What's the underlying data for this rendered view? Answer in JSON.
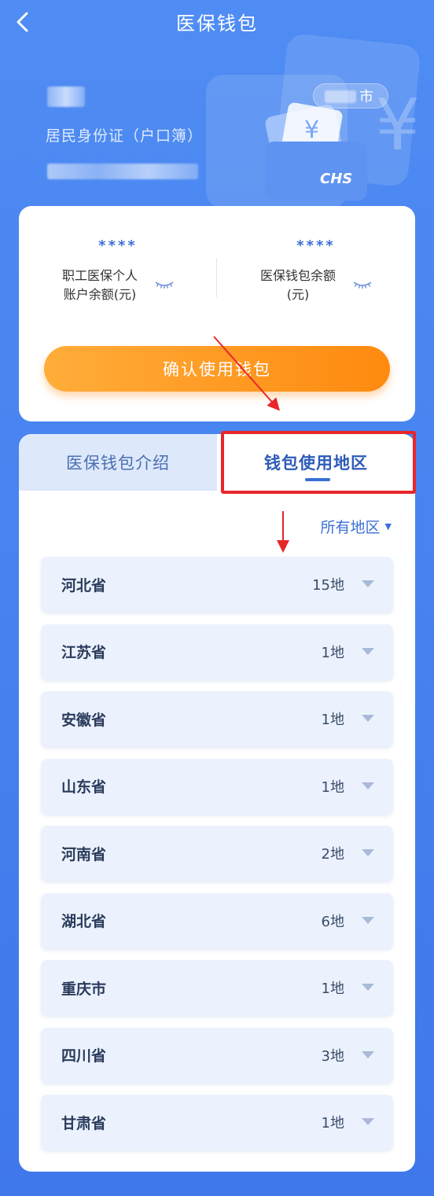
{
  "header": {
    "title": "医保钱包"
  },
  "hero": {
    "id_type": "居民身份证（户口簿）",
    "city_suffix": "市"
  },
  "balance": {
    "left": {
      "amount": "****",
      "label_line1": "职工医保个人",
      "label_line2": "账户余额(元)"
    },
    "right": {
      "amount": "****",
      "label_line1": "医保钱包余额",
      "label_line2": "(元)"
    },
    "confirm_label": "确认使用钱包"
  },
  "tabs": [
    {
      "label": "医保钱包介绍",
      "active": false
    },
    {
      "label": "钱包使用地区",
      "active": true
    }
  ],
  "filter": {
    "label": "所有地区"
  },
  "regions": [
    {
      "name": "河北省",
      "count": "15地"
    },
    {
      "name": "江苏省",
      "count": "1地"
    },
    {
      "name": "安徽省",
      "count": "1地"
    },
    {
      "name": "山东省",
      "count": "1地"
    },
    {
      "name": "河南省",
      "count": "2地"
    },
    {
      "name": "湖北省",
      "count": "6地"
    },
    {
      "name": "重庆市",
      "count": "1地"
    },
    {
      "name": "四川省",
      "count": "3地"
    },
    {
      "name": "甘肃省",
      "count": "1地"
    }
  ],
  "colors": {
    "accent": "#3b6fd6",
    "button": "#ff8a0f",
    "highlight": "#e8262a"
  }
}
